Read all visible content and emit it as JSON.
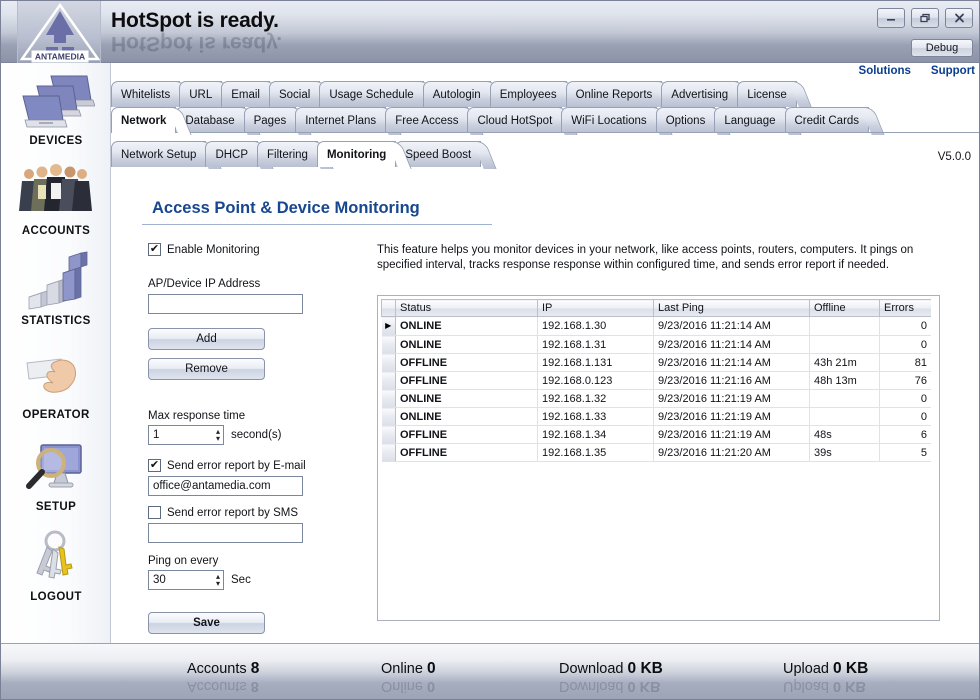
{
  "window": {
    "title": "HotSpot is ready.",
    "logo_text": "ANTAMEDIA",
    "minimize_label": "–",
    "maximize_label": "❐",
    "close_label": "✕",
    "debug_label": "Debug",
    "version": "V5.0.0"
  },
  "top_links": {
    "solutions": "Solutions",
    "support": "Support"
  },
  "sidebar": {
    "items": [
      {
        "label": "DEVICES",
        "icon": "laptops-icon"
      },
      {
        "label": "ACCOUNTS",
        "icon": "people-group-icon"
      },
      {
        "label": "STATISTICS",
        "icon": "bar-chart-icon"
      },
      {
        "label": "OPERATOR",
        "icon": "hand-card-icon"
      },
      {
        "label": "SETUP",
        "icon": "magnifier-monitor-icon"
      },
      {
        "label": "LOGOUT",
        "icon": "keys-icon"
      }
    ]
  },
  "tabs": {
    "row1": [
      {
        "label": "Whitelists",
        "active": false
      },
      {
        "label": "URL",
        "active": false
      },
      {
        "label": "Email",
        "active": false
      },
      {
        "label": "Social",
        "active": false
      },
      {
        "label": "Usage Schedule",
        "active": false
      },
      {
        "label": "Autologin",
        "active": false
      },
      {
        "label": "Employees",
        "active": false
      },
      {
        "label": "Online Reports",
        "active": false
      },
      {
        "label": "Advertising",
        "active": false
      },
      {
        "label": "License",
        "active": false
      }
    ],
    "row2": [
      {
        "label": "Network",
        "active": true
      },
      {
        "label": "Database",
        "active": false
      },
      {
        "label": "Pages",
        "active": false
      },
      {
        "label": "Internet Plans",
        "active": false
      },
      {
        "label": "Free Access",
        "active": false
      },
      {
        "label": "Cloud HotSpot",
        "active": false
      },
      {
        "label": "WiFi Locations",
        "active": false
      },
      {
        "label": "Options",
        "active": false
      },
      {
        "label": "Language",
        "active": false
      },
      {
        "label": "Credit Cards",
        "active": false
      }
    ],
    "row3": [
      {
        "label": "Network Setup",
        "active": false
      },
      {
        "label": "DHCP",
        "active": false
      },
      {
        "label": "Filtering",
        "active": false
      },
      {
        "label": "Monitoring",
        "active": true
      },
      {
        "label": "Speed Boost",
        "active": false
      }
    ]
  },
  "page": {
    "title": "Access Point & Device Monitoring",
    "description": "This feature helps you monitor devices in your network, like access points, routers, computers. It pings on specified interval, tracks response response within configured time, and sends error report if needed."
  },
  "form": {
    "enable_monitoring_label": "Enable Monitoring",
    "enable_monitoring_checked": true,
    "ip_label": "AP/Device IP Address",
    "ip_value": "",
    "ip_placeholder": "",
    "add_label": "Add",
    "remove_label": "Remove",
    "max_response_label": "Max response time",
    "max_response_value": "1",
    "max_response_unit": "second(s)",
    "email_checkbox_label": "Send error report by E-mail",
    "email_checked": true,
    "email_value": "office@antamedia.com",
    "sms_checkbox_label": "Send error report by SMS",
    "sms_checked": false,
    "sms_value": "",
    "ping_label": "Ping on every",
    "ping_value": "30",
    "ping_unit": "Sec",
    "save_label": "Save",
    "check_glyph": "✔",
    "spinner_glyph_up": "▴",
    "spinner_glyph_down": "▾"
  },
  "table": {
    "columns": [
      "Status",
      "IP",
      "Last Ping",
      "Offline",
      "Errors"
    ],
    "row_marker": "▶",
    "rows": [
      {
        "selected": true,
        "status": "ONLINE",
        "ip": "192.168.1.30",
        "last_ping": "9/23/2016 11:21:14 AM",
        "offline": "",
        "errors": "0"
      },
      {
        "selected": false,
        "status": "ONLINE",
        "ip": "192.168.1.31",
        "last_ping": "9/23/2016 11:21:14 AM",
        "offline": "",
        "errors": "0"
      },
      {
        "selected": false,
        "status": "OFFLINE",
        "ip": "192.168.1.131",
        "last_ping": "9/23/2016 11:21:14 AM",
        "offline": "43h 21m",
        "errors": "81"
      },
      {
        "selected": false,
        "status": "OFFLINE",
        "ip": "192.168.0.123",
        "last_ping": "9/23/2016 11:21:16 AM",
        "offline": "48h 13m",
        "errors": "76"
      },
      {
        "selected": false,
        "status": "ONLINE",
        "ip": "192.168.1.32",
        "last_ping": "9/23/2016 11:21:19 AM",
        "offline": "",
        "errors": "0"
      },
      {
        "selected": false,
        "status": "ONLINE",
        "ip": "192.168.1.33",
        "last_ping": "9/23/2016 11:21:19 AM",
        "offline": "",
        "errors": "0"
      },
      {
        "selected": false,
        "status": "OFFLINE",
        "ip": "192.168.1.34",
        "last_ping": "9/23/2016 11:21:19 AM",
        "offline": "48s",
        "errors": "6"
      },
      {
        "selected": false,
        "status": "OFFLINE",
        "ip": "192.168.1.35",
        "last_ping": "9/23/2016 11:21:20 AM",
        "offline": "39s",
        "errors": "5"
      }
    ]
  },
  "statusbar": {
    "items": [
      {
        "label": "Accounts",
        "value": "8"
      },
      {
        "label": "Online",
        "value": "0"
      },
      {
        "label": "Download",
        "value": "0 KB"
      },
      {
        "label": "Upload",
        "value": "0 KB"
      }
    ]
  },
  "colors": {
    "online": "#00cc00",
    "offline": "#e01b24",
    "accent_blue": "#17478f",
    "link_blue": "#0a3d91",
    "logo_purple": "#6b6fa8"
  }
}
